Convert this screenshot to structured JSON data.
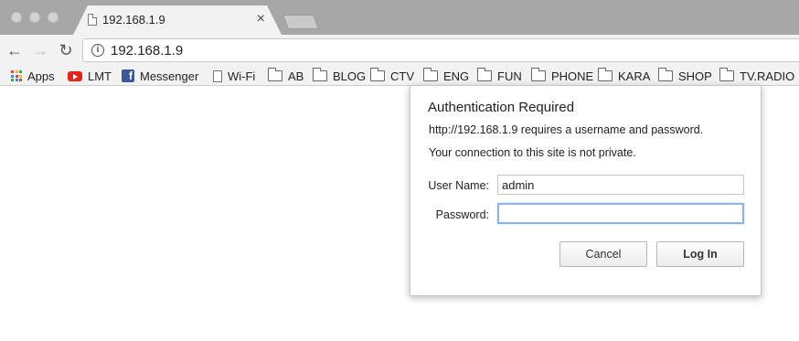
{
  "tab": {
    "title": "192.168.1.9",
    "close_label": "×"
  },
  "toolbar": {
    "back_icon": "←",
    "forward_icon": "→",
    "reload_icon": "↻",
    "url": "192.168.1.9",
    "info_glyph": "i"
  },
  "bookmarks": [
    {
      "label": "Apps",
      "icon": "apps-grid-icon"
    },
    {
      "label": "LMT",
      "icon": "youtube-icon"
    },
    {
      "label": "Messenger",
      "icon": "facebook-icon"
    },
    {
      "label": "Wi-Fi",
      "icon": "page-icon"
    },
    {
      "label": "AB",
      "icon": "folder-icon"
    },
    {
      "label": "BLOG",
      "icon": "folder-icon"
    },
    {
      "label": "CTV",
      "icon": "folder-icon"
    },
    {
      "label": "ENG",
      "icon": "folder-icon"
    },
    {
      "label": "FUN",
      "icon": "folder-icon"
    },
    {
      "label": "PHONE",
      "icon": "folder-icon"
    },
    {
      "label": "KARA",
      "icon": "folder-icon"
    },
    {
      "label": "SHOP",
      "icon": "folder-icon"
    },
    {
      "label": "TV.RADIO",
      "icon": "folder-icon"
    }
  ],
  "dialog": {
    "title": "Authentication Required",
    "message": "http://192.168.1.9 requires a username and password.",
    "warning": "Your connection to this site is not private.",
    "username_label": "User Name:",
    "username_value": "admin",
    "password_label": "Password:",
    "password_value": "",
    "cancel_label": "Cancel",
    "login_label": "Log In"
  },
  "colors": {
    "tab_strip": "#a7a7a7",
    "toolbar": "#f2f2f2",
    "focus_ring": "#8db3e6",
    "youtube": "#e62117",
    "facebook": "#3b5998"
  }
}
